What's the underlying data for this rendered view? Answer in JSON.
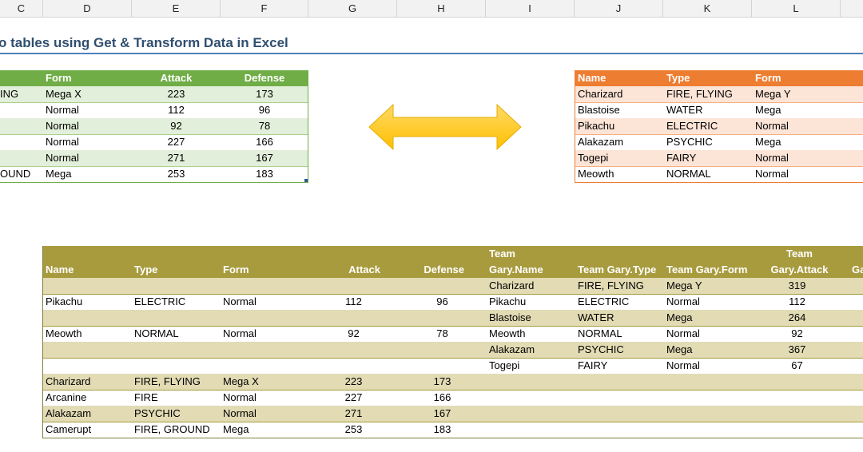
{
  "column_headers": [
    "C",
    "D",
    "E",
    "F",
    "G",
    "H",
    "I",
    "J",
    "K",
    "L"
  ],
  "title": "o tables using Get & Transform Data in Excel",
  "green_table": {
    "headers": [
      "Form",
      "Attack",
      "Defense"
    ],
    "rows": [
      {
        "type_tail": "ING",
        "form": "Mega X",
        "attack": "223",
        "defense": "173"
      },
      {
        "type_tail": "",
        "form": "Normal",
        "attack": "112",
        "defense": "96"
      },
      {
        "type_tail": "",
        "form": "Normal",
        "attack": "92",
        "defense": "78"
      },
      {
        "type_tail": "",
        "form": "Normal",
        "attack": "227",
        "defense": "166"
      },
      {
        "type_tail": "",
        "form": "Normal",
        "attack": "271",
        "defense": "167"
      },
      {
        "type_tail": "OUND",
        "form": "Mega",
        "attack": "253",
        "defense": "183"
      }
    ]
  },
  "orange_table": {
    "headers": [
      "Name",
      "Type",
      "Form"
    ],
    "rows": [
      {
        "name": "Charizard",
        "type": "FIRE, FLYING",
        "form": "Mega Y"
      },
      {
        "name": "Blastoise",
        "type": "WATER",
        "form": "Mega"
      },
      {
        "name": "Pikachu",
        "type": "ELECTRIC",
        "form": "Normal"
      },
      {
        "name": "Alakazam",
        "type": "PSYCHIC",
        "form": "Mega"
      },
      {
        "name": "Togepi",
        "type": "FAIRY",
        "form": "Normal"
      },
      {
        "name": "Meowth",
        "type": "NORMAL",
        "form": "Normal"
      }
    ]
  },
  "merged_table": {
    "headers": {
      "name": "Name",
      "type": "Type",
      "form": "Form",
      "attack": "Attack",
      "defense": "Defense",
      "tg_name_1": "Team",
      "tg_name_2": "Gary.Name",
      "tg_type": "Team Gary.Type",
      "tg_form": "Team Gary.Form",
      "tg_attack_1": "Team",
      "tg_attack_2": "Gary.Attack",
      "tg_cut": "Ga"
    },
    "rows": [
      {
        "name": "",
        "type": "",
        "form": "",
        "attack": "",
        "defense": "",
        "tg_name": "Charizard",
        "tg_type": "FIRE, FLYING",
        "tg_form": "Mega Y",
        "tg_attack": "319"
      },
      {
        "name": "Pikachu",
        "type": "ELECTRIC",
        "form": "Normal",
        "attack": "112",
        "defense": "96",
        "tg_name": "Pikachu",
        "tg_type": "ELECTRIC",
        "tg_form": "Normal",
        "tg_attack": "112"
      },
      {
        "name": "",
        "type": "",
        "form": "",
        "attack": "",
        "defense": "",
        "tg_name": "Blastoise",
        "tg_type": "WATER",
        "tg_form": "Mega",
        "tg_attack": "264"
      },
      {
        "name": "Meowth",
        "type": "NORMAL",
        "form": "Normal",
        "attack": "92",
        "defense": "78",
        "tg_name": "Meowth",
        "tg_type": "NORMAL",
        "tg_form": "Normal",
        "tg_attack": "92"
      },
      {
        "name": "",
        "type": "",
        "form": "",
        "attack": "",
        "defense": "",
        "tg_name": "Alakazam",
        "tg_type": "PSYCHIC",
        "tg_form": "Mega",
        "tg_attack": "367"
      },
      {
        "name": "",
        "type": "",
        "form": "",
        "attack": "",
        "defense": "",
        "tg_name": "Togepi",
        "tg_type": "FAIRY",
        "tg_form": "Normal",
        "tg_attack": "67"
      },
      {
        "name": "Charizard",
        "type": "FIRE, FLYING",
        "form": "Mega X",
        "attack": "223",
        "defense": "173",
        "tg_name": "",
        "tg_type": "",
        "tg_form": "",
        "tg_attack": ""
      },
      {
        "name": "Arcanine",
        "type": "FIRE",
        "form": "Normal",
        "attack": "227",
        "defense": "166",
        "tg_name": "",
        "tg_type": "",
        "tg_form": "",
        "tg_attack": ""
      },
      {
        "name": "Alakazam",
        "type": "PSYCHIC",
        "form": "Normal",
        "attack": "271",
        "defense": "167",
        "tg_name": "",
        "tg_type": "",
        "tg_form": "",
        "tg_attack": ""
      },
      {
        "name": "Camerupt",
        "type": "FIRE, GROUND",
        "form": "Mega",
        "attack": "253",
        "defense": "183",
        "tg_name": "",
        "tg_type": "",
        "tg_form": "",
        "tg_attack": ""
      }
    ]
  },
  "colors": {
    "green_header": "#70ad47",
    "orange_header": "#ed7d31",
    "merged_header": "#a89b3e",
    "arrow": "#ffc000"
  },
  "icons": {
    "arrow": "double-headed-arrow-icon"
  }
}
